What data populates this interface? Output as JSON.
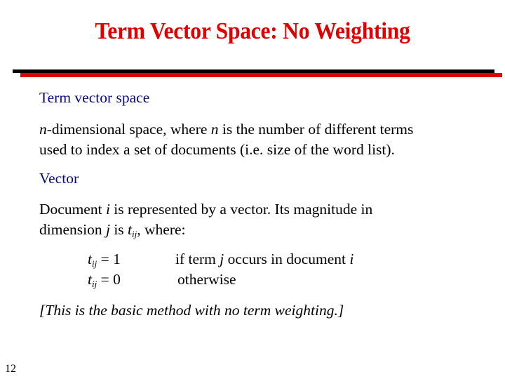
{
  "slide": {
    "title": "Term Vector Space: No Weighting",
    "page_number": "12",
    "colors": {
      "title": "#E00000",
      "heading": "#0A0A80",
      "rule_black": "#000000",
      "rule_red": "#E00000"
    }
  },
  "sections": [
    {
      "heading": "Term vector space",
      "body": {
        "var_n1": "n",
        "text1": "-dimensional space, where ",
        "var_n2": "n",
        "text2": " is the number of different terms",
        "line2": "used to index a set of documents (i.e. size of the word list)."
      }
    },
    {
      "heading": "Vector",
      "body": {
        "text1": "Document ",
        "var_i": "i",
        "text2": " is represented by a vector.  Its magnitude in",
        "line2_text1": "dimension ",
        "var_j": "j",
        "line2_text2": " is ",
        "var_t": "t",
        "sub_ij": "ij",
        "line2_text3": ", where:"
      }
    }
  ],
  "formulas": [
    {
      "var": "t",
      "sub": "ij",
      "eq": " = 1",
      "cond_text1": "if term ",
      "cond_var1": "j",
      "cond_text2": " occurs in document ",
      "cond_var2": "i"
    },
    {
      "var": "t",
      "sub": "ij",
      "eq": " = 0",
      "cond_text1": "otherwise"
    }
  ],
  "note": "[This is the basic method with no term weighting.]"
}
